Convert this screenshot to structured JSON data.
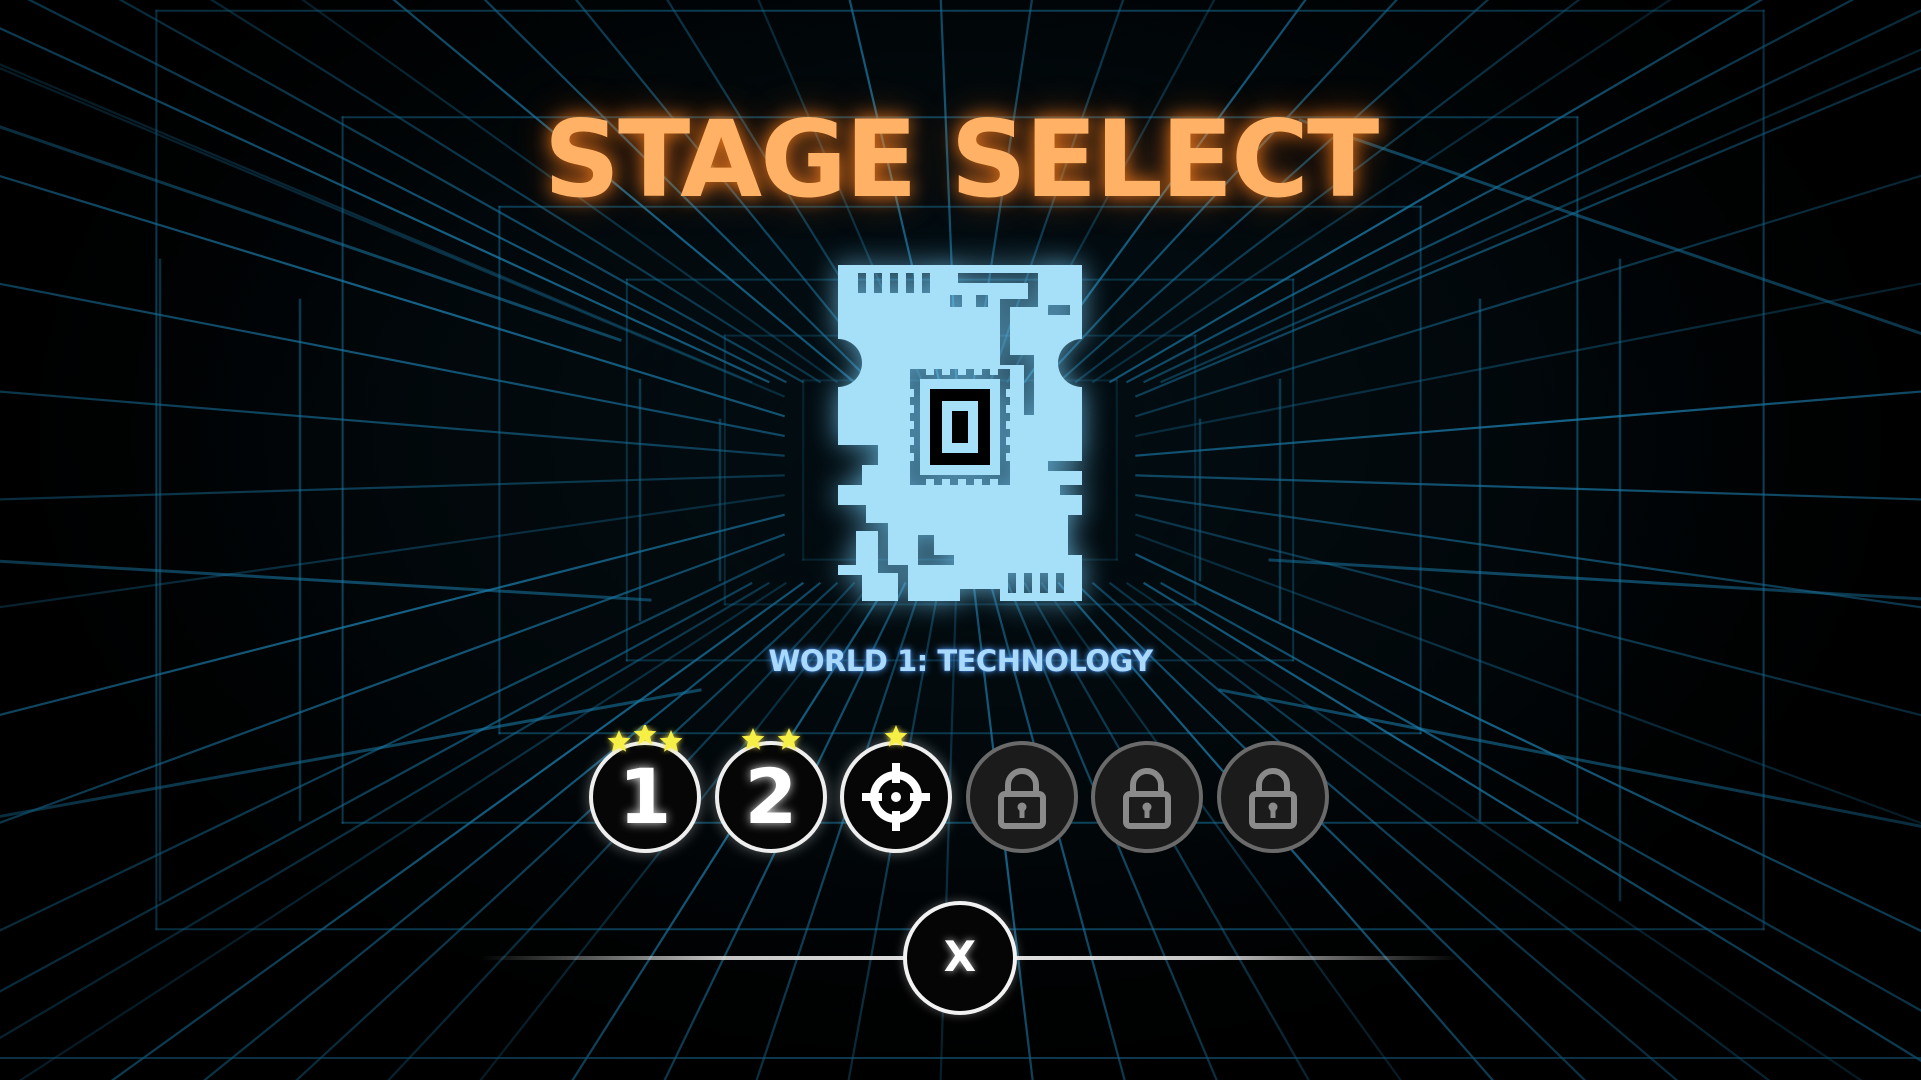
{
  "title": "STAGE SELECT",
  "world": {
    "name": "WORLD 1: TECHNOLOGY",
    "icon": "circuit-chip-icon",
    "icon_color": "#a6dff8"
  },
  "stages": [
    {
      "label": "1",
      "state": "completed",
      "stars": 3,
      "icon": null
    },
    {
      "label": "2",
      "state": "completed",
      "stars": 2,
      "icon": null
    },
    {
      "label": "",
      "state": "current",
      "stars": 1,
      "icon": "crosshair-icon"
    },
    {
      "label": "",
      "state": "locked",
      "stars": 0,
      "icon": "lock-icon"
    },
    {
      "label": "",
      "state": "locked",
      "stars": 0,
      "icon": "lock-icon"
    },
    {
      "label": "",
      "state": "locked",
      "stars": 0,
      "icon": "lock-icon"
    }
  ],
  "close_button": {
    "label": "X"
  },
  "colors": {
    "title": "#ffb266",
    "world_name": "#a9d9fb",
    "star": "#f6ef46",
    "grid": "#1f8fc4"
  }
}
